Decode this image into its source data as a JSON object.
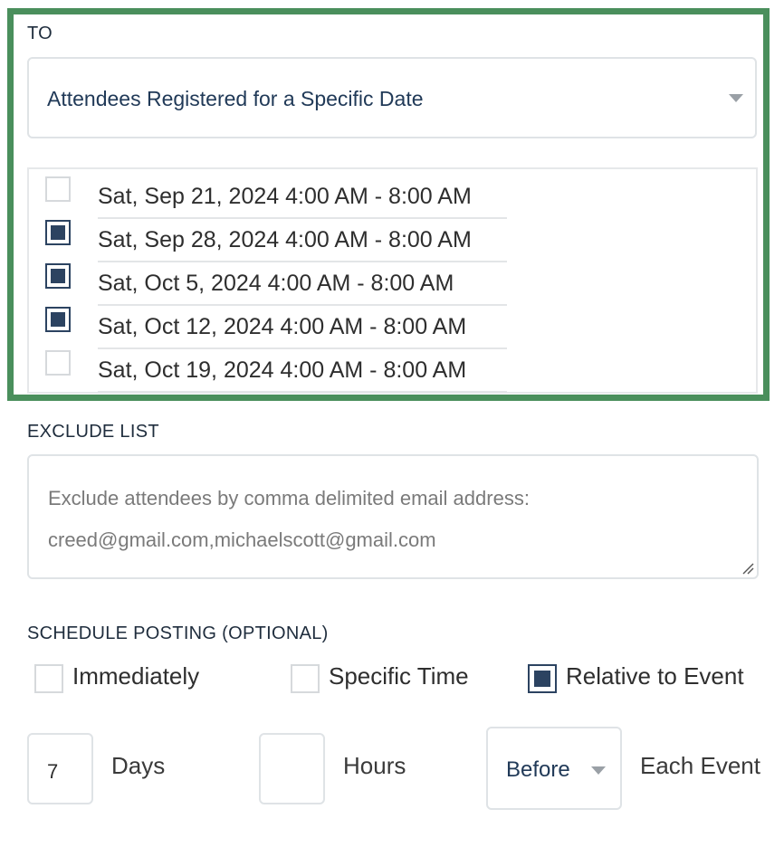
{
  "to": {
    "label": "TO",
    "recipient_select": "Attendees Registered for a Specific Date",
    "dates": [
      {
        "label": "Sat, Sep 21, 2024 4:00 AM - 8:00 AM",
        "checked": false
      },
      {
        "label": "Sat, Sep 28, 2024 4:00 AM - 8:00 AM",
        "checked": true
      },
      {
        "label": "Sat, Oct 5, 2024 4:00 AM - 8:00 AM",
        "checked": true
      },
      {
        "label": "Sat, Oct 12, 2024 4:00 AM - 8:00 AM",
        "checked": true
      },
      {
        "label": "Sat, Oct 19, 2024 4:00 AM - 8:00 AM",
        "checked": false
      }
    ]
  },
  "exclude": {
    "label": "EXCLUDE LIST",
    "placeholder_line1": "Exclude attendees by comma delimited email address:",
    "placeholder_line2": "creed@gmail.com,michaelscott@gmail.com"
  },
  "schedule": {
    "label": "SCHEDULE POSTING (OPTIONAL)",
    "options": [
      {
        "label": "Immediately",
        "checked": false
      },
      {
        "label": "Specific Time",
        "checked": false
      },
      {
        "label": "Relative to Event",
        "checked": true
      }
    ],
    "days_value": "7",
    "days_label": "Days",
    "hours_value": "",
    "hours_label": "Hours",
    "direction": "Before",
    "each_event_label": "Each Event"
  },
  "colors": {
    "highlight_border": "#4a8f5c",
    "checkbox_fill": "#2c4361",
    "select_text": "#213a58"
  },
  "icons": {
    "dropdown": "chevron-down-icon",
    "resize": "resize-grip-icon"
  }
}
